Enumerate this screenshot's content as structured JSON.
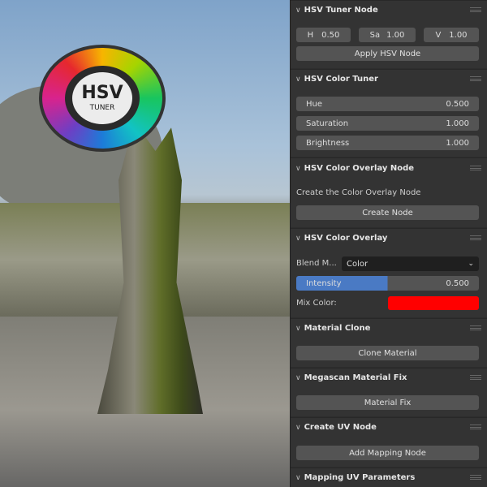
{
  "logo": {
    "title": "HSV",
    "subtitle": "TUNER"
  },
  "panels": {
    "tuner_node": {
      "title": "HSV Tuner Node",
      "h_label": "H",
      "h_value": "0.50",
      "s_label": "Sa",
      "s_value": "1.00",
      "v_label": "V",
      "v_value": "1.00",
      "apply": "Apply HSV Node"
    },
    "color_tuner": {
      "title": "HSV Color Tuner",
      "fields": [
        {
          "label": "Hue",
          "value": "0.500"
        },
        {
          "label": "Saturation",
          "value": "1.000"
        },
        {
          "label": "Brightness",
          "value": "1.000"
        }
      ]
    },
    "overlay_node": {
      "title": "HSV Color Overlay Node",
      "description": "Create the Color Overlay Node",
      "button": "Create Node"
    },
    "overlay": {
      "title": "HSV Color Overlay",
      "blend_label": "Blend M...",
      "blend_value": "Color",
      "intensity_label": "Intensity",
      "intensity_value": "0.500",
      "intensity_fraction": 0.5,
      "mix_label": "Mix Color:",
      "mix_color": "#ff0000"
    },
    "material_clone": {
      "title": "Material Clone",
      "button": "Clone Material"
    },
    "megascan": {
      "title": "Megascan Material Fix",
      "button": "Material Fix"
    },
    "uv_node": {
      "title": "Create UV Node",
      "button": "Add Mapping Node"
    },
    "mapping_uv": {
      "title": "Mapping UV Parameters"
    }
  },
  "colors": {
    "accent": "#4a7ac4",
    "panel_bg": "#333333",
    "button_bg": "#545454"
  }
}
